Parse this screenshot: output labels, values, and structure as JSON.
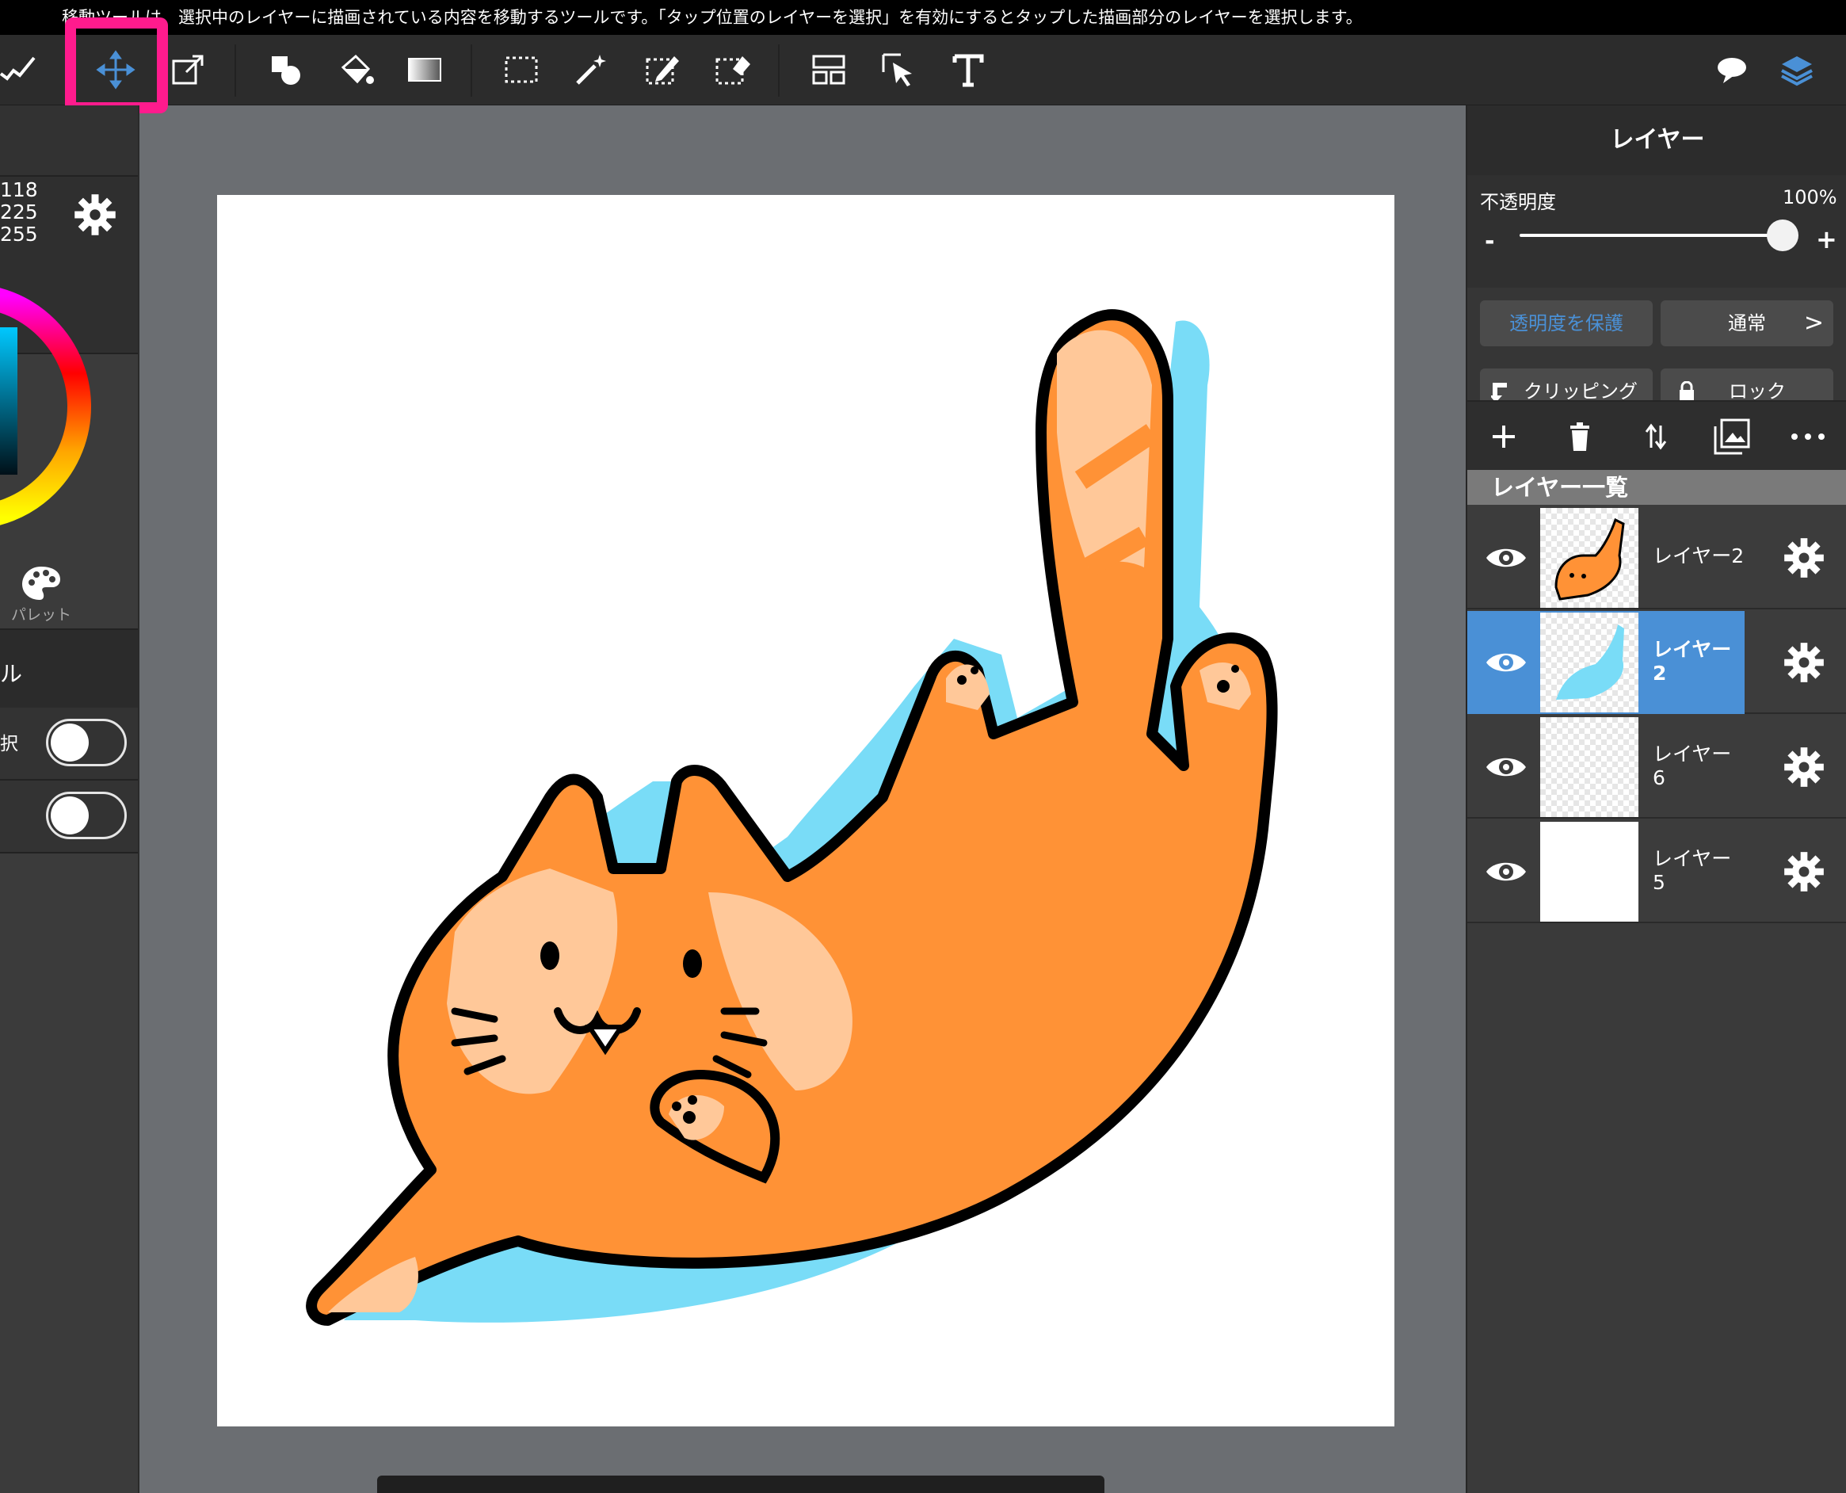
{
  "hint": {
    "text": "移動ツールは、選択中のレイヤーに描画されている内容を移動するツールです。「タップ位置のレイヤーを選択」を有効にするとタップした描画部分のレイヤーを選択します。"
  },
  "toolbar": {
    "tools": [
      "brush-tool",
      "move-tool",
      "transform-tool",
      "shape-tool",
      "fill-tool",
      "gradient-tool",
      "select-rect-tool",
      "magic-wand-tool",
      "select-pen-tool",
      "select-eraser-tool",
      "layout-tool",
      "operation-tool",
      "text-tool"
    ],
    "active_tool": "move-tool",
    "accent": "#4a90d6",
    "highlight": "#ff1b8d"
  },
  "left_panel": {
    "rgb": [
      "118",
      "225",
      "255"
    ],
    "palette_label": "パレット",
    "section_glyph": "ル",
    "toggle1_label": "択",
    "toggle1_on": false,
    "toggle2_on": false
  },
  "right_panel": {
    "title": "レイヤー",
    "opacity_label": "不透明度",
    "opacity_value": "100%",
    "opacity_fraction": 1.0,
    "minus": "-",
    "plus": "+",
    "protect_alpha": "透明度を保護",
    "blend_mode": "通常",
    "chevron": ">",
    "clipping": "クリッピング",
    "lock": "ロック",
    "list_header": "レイヤー一覧",
    "layers": [
      {
        "name": "レイヤー2",
        "selected": false,
        "thumb": "cat"
      },
      {
        "name": "レイヤー\n2",
        "selected": true,
        "thumb": "shadow"
      },
      {
        "name": "レイヤー\n6",
        "selected": false,
        "thumb": "empty"
      },
      {
        "name": "レイヤー\n5",
        "selected": false,
        "thumb": "white"
      }
    ]
  }
}
